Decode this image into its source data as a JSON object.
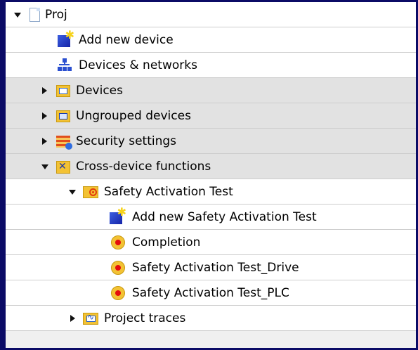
{
  "tree": {
    "items": [
      {
        "label": "Proj",
        "expanded": true,
        "icon": "project-file-icon"
      },
      {
        "label": "Add new device",
        "icon": "add-new-device-icon"
      },
      {
        "label": "Devices & networks",
        "icon": "network-icon"
      },
      {
        "label": "Devices",
        "expanded": false,
        "icon": "devices-folder-icon"
      },
      {
        "label": "Ungrouped devices",
        "expanded": false,
        "icon": "ungrouped-devices-icon"
      },
      {
        "label": "Security settings",
        "expanded": false,
        "icon": "security-settings-icon"
      },
      {
        "label": "Cross-device functions",
        "expanded": true,
        "icon": "cross-device-icon"
      },
      {
        "label": "Safety Activation Test",
        "expanded": true,
        "icon": "safety-folder-icon"
      },
      {
        "label": "Add new Safety Activation Test",
        "icon": "add-new-icon"
      },
      {
        "label": "Completion",
        "icon": "safety-test-icon"
      },
      {
        "label": "Safety Activation Test_Drive",
        "icon": "safety-test-icon"
      },
      {
        "label": "Safety Activation Test_PLC",
        "icon": "safety-test-icon"
      },
      {
        "label": "Project traces",
        "expanded": false,
        "icon": "project-traces-icon"
      }
    ]
  },
  "colors": {
    "background": "#0b0b66",
    "row": "#ffffff",
    "row_shaded": "#e2e2e2",
    "folder": "#f3c234",
    "accent_blue": "#2a4fd0",
    "safety_red": "#e40d0d"
  }
}
